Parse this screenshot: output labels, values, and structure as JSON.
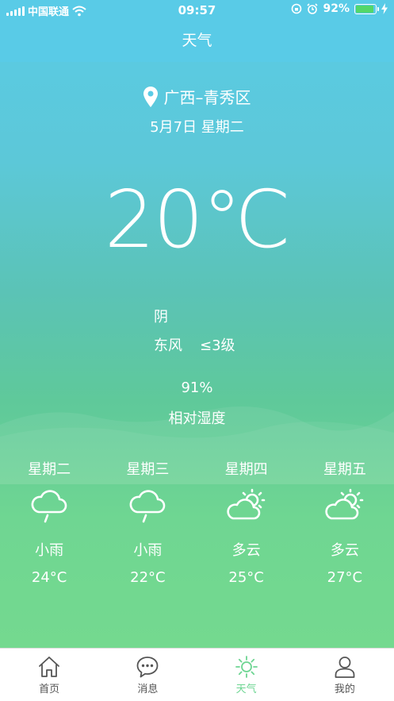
{
  "status_bar": {
    "carrier": "中国联通",
    "time": "09:57",
    "battery": "92%",
    "battery_level": 0.92
  },
  "page_title": "天气",
  "location": "广西–青秀区",
  "date": "5月7日  星期二",
  "temperature": "20℃",
  "condition": "阴",
  "wind": {
    "direction": "东风",
    "level": "≤3级"
  },
  "humidity": {
    "value": "91%",
    "label": "相对湿度"
  },
  "forecast": [
    {
      "day": "星期二",
      "icon": "rain-cloud-icon",
      "condition": "小雨",
      "temp": "24°C"
    },
    {
      "day": "星期三",
      "icon": "rain-cloud-icon",
      "condition": "小雨",
      "temp": "22°C"
    },
    {
      "day": "星期四",
      "icon": "partly-cloudy-icon",
      "condition": "多云",
      "temp": "25°C"
    },
    {
      "day": "星期五",
      "icon": "partly-cloudy-icon",
      "condition": "多云",
      "temp": "27°C"
    }
  ],
  "tabs": [
    {
      "label": "首页",
      "icon": "home-icon"
    },
    {
      "label": "消息",
      "icon": "message-icon"
    },
    {
      "label": "天气",
      "icon": "sun-icon",
      "active": true
    },
    {
      "label": "我的",
      "icon": "user-icon"
    }
  ],
  "colors": {
    "active_tab": "#6dd592",
    "battery_fill": "#53d769"
  }
}
